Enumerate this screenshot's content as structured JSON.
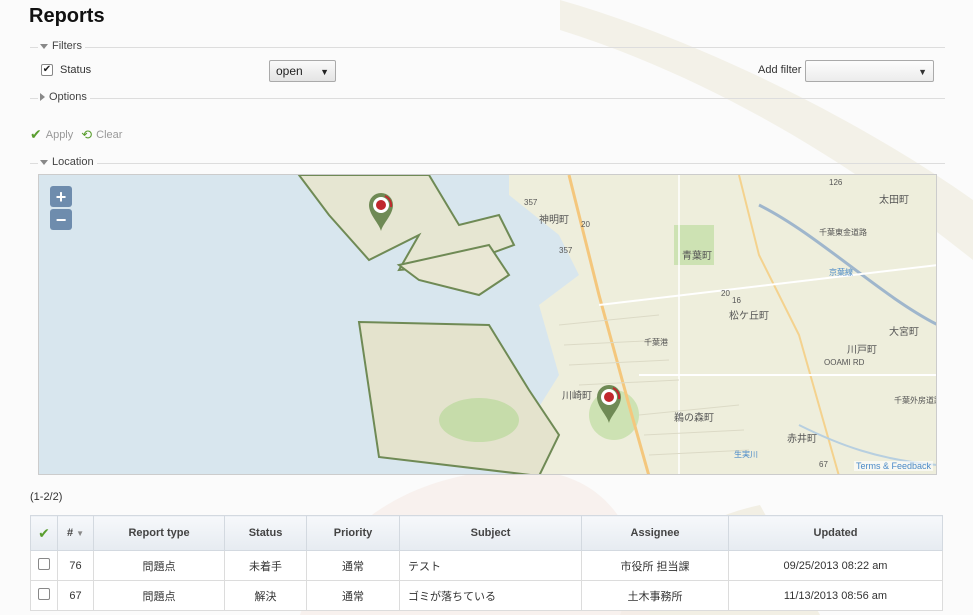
{
  "page": {
    "title": "Reports"
  },
  "filters": {
    "legend": "Filters",
    "status_label": "Status",
    "status_checked": true,
    "status_value": "open",
    "add_filter_label": "Add filter",
    "add_filter_value": ""
  },
  "options": {
    "legend": "Options"
  },
  "actions": {
    "apply": "Apply",
    "clear": "Clear"
  },
  "location": {
    "legend": "Location",
    "zoom_in": "+",
    "zoom_out": "−",
    "credit": "Terms & Feedback",
    "labels": [
      "357",
      "神明町",
      "357",
      "20",
      "126",
      "太田町",
      "青葉町",
      "千葉東金道路",
      "20",
      "松ケ丘町",
      "16",
      "京葉線",
      "川崎町",
      "千葉港",
      "鵜の森町",
      "大宮町",
      "川戸町",
      "赤井町",
      "67",
      "生実川",
      "千葉外房道路",
      "OOAMI RD"
    ]
  },
  "count_text": "(1-2/2)",
  "table": {
    "headers": [
      "#",
      "Report type",
      "Status",
      "Priority",
      "Subject",
      "Assignee",
      "Updated"
    ],
    "rows": [
      {
        "id": "76",
        "type": "問題点",
        "status": "未着手",
        "priority": "通常",
        "subject": "テスト",
        "assignee": "市役所 担当課",
        "updated": "09/25/2013 08:22 am"
      },
      {
        "id": "67",
        "type": "問題点",
        "status": "解決",
        "priority": "通常",
        "subject": "ゴミが落ちている",
        "assignee": "土木事務所",
        "updated": "11/13/2013 08:56 am"
      }
    ]
  },
  "colors": {
    "accent_green": "#5a9e2f",
    "map_water": "#d8e6ee",
    "map_land": "#eeeedc"
  }
}
